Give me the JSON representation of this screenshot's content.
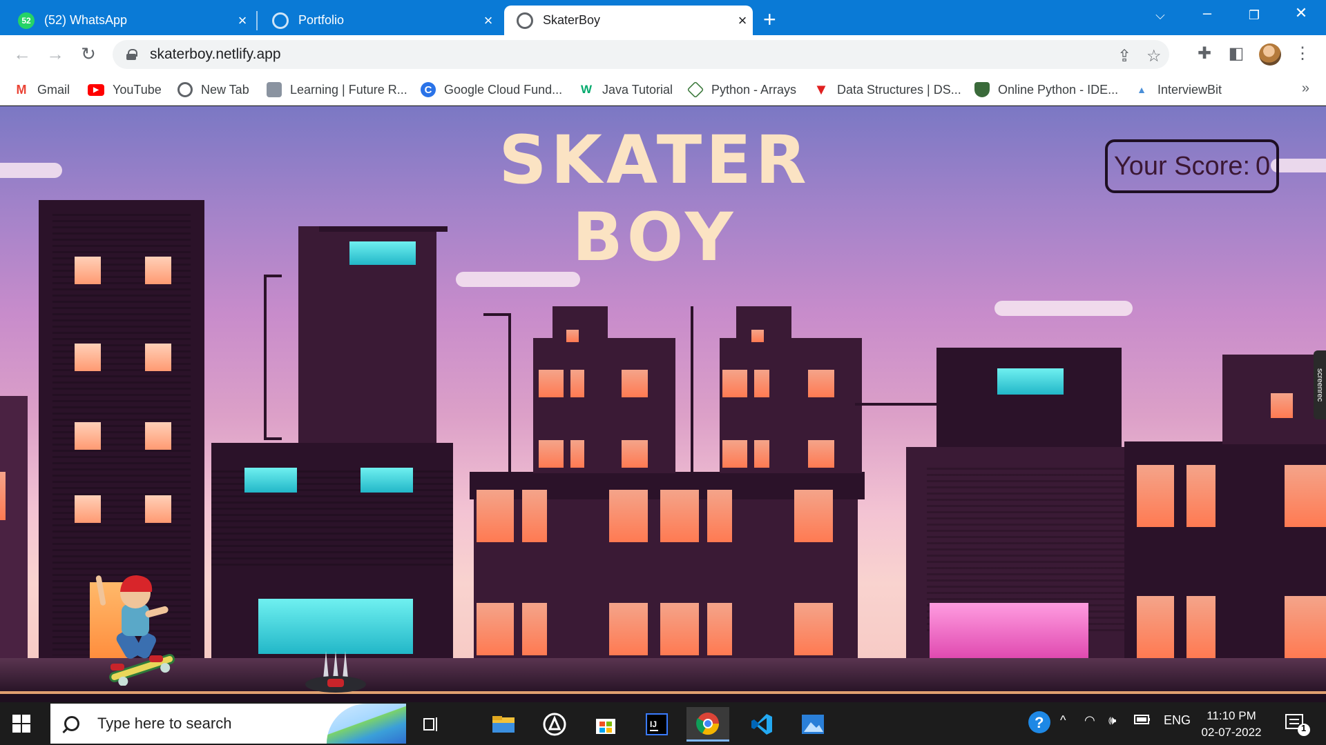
{
  "browser": {
    "tabs": [
      {
        "title": "(52) WhatsApp",
        "badge": "52",
        "icon": "whatsapp-icon"
      },
      {
        "title": "Portfolio",
        "icon": "globe-icon"
      },
      {
        "title": "SkaterBoy",
        "icon": "globe-icon",
        "active": true
      }
    ],
    "url": "skaterboy.netlify.app",
    "bookmarks": [
      {
        "label": "Gmail",
        "icon": "gmail-icon"
      },
      {
        "label": "YouTube",
        "icon": "youtube-icon"
      },
      {
        "label": "New Tab",
        "icon": "globe-icon"
      },
      {
        "label": "Learning | Future R...",
        "icon": "learning-icon"
      },
      {
        "label": "Google Cloud Fund...",
        "icon": "coursera-icon"
      },
      {
        "label": "Java Tutorial",
        "icon": "w3schools-icon"
      },
      {
        "label": "Python - Arrays",
        "icon": "tutorialspoint-icon"
      },
      {
        "label": "Data Structures | DS...",
        "icon": "gfg-icon"
      },
      {
        "label": "Online Python - IDE...",
        "icon": "online-python-icon"
      },
      {
        "label": "InterviewBit",
        "icon": "interviewbit-icon"
      }
    ]
  },
  "game": {
    "title": "SKATER BOY",
    "score_label": "Your Score:",
    "score_value": "0"
  },
  "overlay": {
    "recorder_label": "screenrec"
  },
  "taskbar": {
    "search_placeholder": "Type here to search",
    "language": "ENG",
    "time": "11:10 PM",
    "date": "02-07-2022",
    "notification_count": "1"
  },
  "colors": {
    "tabstrip": "#0a7ad6",
    "title_text": "#fbe3c3",
    "score_border": "#1e0f23"
  }
}
